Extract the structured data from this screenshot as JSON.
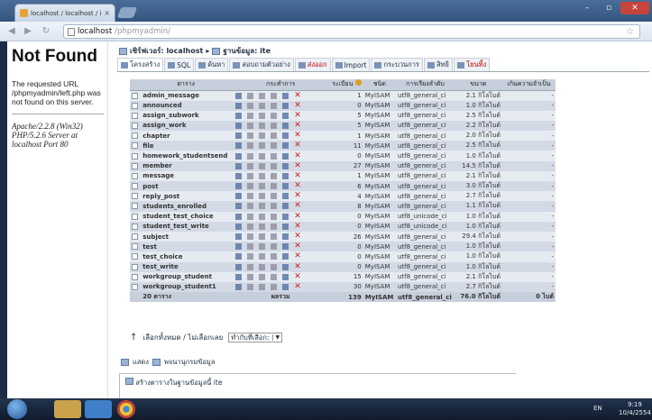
{
  "browser": {
    "tab_title": "localhost / localhost / ite ...",
    "url_host": "localhost",
    "url_path": "/phpmyadmin/"
  },
  "not_found": {
    "title": "Not Found",
    "message": "The requested URL /phpmyadmin/left.php was not found on this server.",
    "server": "Apache/2.2.8 (Win32) PHP/5.2.6 Server at localhost Port 80"
  },
  "breadcrumb": {
    "server": "เซิร์ฟเวอร์: localhost",
    "sep": "▸",
    "db": "ฐานข้อมูล: ite"
  },
  "tabs": [
    {
      "label": "โครงสร้าง",
      "style": "active"
    },
    {
      "label": "SQL",
      "style": ""
    },
    {
      "label": "ค้นหา",
      "style": ""
    },
    {
      "label": "สอบถามตัวอย่าง",
      "style": ""
    },
    {
      "label": "ส่งออก",
      "style": "red"
    },
    {
      "label": "Import",
      "style": ""
    },
    {
      "label": "กระบวนการ",
      "style": ""
    },
    {
      "label": "สิทธิ",
      "style": ""
    },
    {
      "label": "โยนทิ้ง",
      "style": "red"
    }
  ],
  "table_headers": {
    "table": "ตาราง",
    "action": "กระทำการ",
    "records": "ระเบียน",
    "type": "ชนิด",
    "collation": "การเรียงลำดับ",
    "size": "ขนาด",
    "overhead": "เกินความจำเป็น"
  },
  "tables": [
    {
      "name": "admin_message",
      "records": "1",
      "engine": "MyISAM",
      "collation": "utf8_general_ci",
      "size": "2.1 กิโลไบต์",
      "overhead": "-"
    },
    {
      "name": "announced",
      "records": "0",
      "engine": "MyISAM",
      "collation": "utf8_general_ci",
      "size": "1.0 กิโลไบต์",
      "overhead": "-"
    },
    {
      "name": "assign_subwork",
      "records": "5",
      "engine": "MyISAM",
      "collation": "utf8_general_ci",
      "size": "2.5 กิโลไบต์",
      "overhead": "-"
    },
    {
      "name": "assign_work",
      "records": "5",
      "engine": "MyISAM",
      "collation": "utf8_general_ci",
      "size": "2.2 กิโลไบต์",
      "overhead": "-"
    },
    {
      "name": "chapter",
      "records": "1",
      "engine": "MyISAM",
      "collation": "utf8_general_ci",
      "size": "2.0 กิโลไบต์",
      "overhead": "-"
    },
    {
      "name": "file",
      "records": "11",
      "engine": "MyISAM",
      "collation": "utf8_general_ci",
      "size": "2.5 กิโลไบต์",
      "overhead": "-"
    },
    {
      "name": "homework_studentsend",
      "records": "0",
      "engine": "MyISAM",
      "collation": "utf8_general_ci",
      "size": "1.0 กิโลไบต์",
      "overhead": "-"
    },
    {
      "name": "member",
      "records": "27",
      "engine": "MyISAM",
      "collation": "utf8_general_ci",
      "size": "14.5 กิโลไบต์",
      "overhead": "-"
    },
    {
      "name": "message",
      "records": "1",
      "engine": "MyISAM",
      "collation": "utf8_general_ci",
      "size": "2.1 กิโลไบต์",
      "overhead": "-"
    },
    {
      "name": "post",
      "records": "6",
      "engine": "MyISAM",
      "collation": "utf8_general_ci",
      "size": "3.0 กิโลไบต์",
      "overhead": "-"
    },
    {
      "name": "reply_post",
      "records": "4",
      "engine": "MyISAM",
      "collation": "utf8_general_ci",
      "size": "2.7 กิโลไบต์",
      "overhead": "-"
    },
    {
      "name": "students_enrolled",
      "records": "8",
      "engine": "MyISAM",
      "collation": "utf8_general_ci",
      "size": "1.1 กิโลไบต์",
      "overhead": "-"
    },
    {
      "name": "student_test_choice",
      "records": "0",
      "engine": "MyISAM",
      "collation": "utf8_unicode_ci",
      "size": "1.0 กิโลไบต์",
      "overhead": "-"
    },
    {
      "name": "student_test_write",
      "records": "0",
      "engine": "MyISAM",
      "collation": "utf8_unicode_ci",
      "size": "1.0 กิโลไบต์",
      "overhead": "-"
    },
    {
      "name": "subject",
      "records": "26",
      "engine": "MyISAM",
      "collation": "utf8_general_ci",
      "size": "29.4 กิโลไบต์",
      "overhead": "-"
    },
    {
      "name": "test",
      "records": "0",
      "engine": "MyISAM",
      "collation": "utf8_general_ci",
      "size": "1.0 กิโลไบต์",
      "overhead": "-"
    },
    {
      "name": "test_choice",
      "records": "0",
      "engine": "MyISAM",
      "collation": "utf8_general_ci",
      "size": "1.0 กิโลไบต์",
      "overhead": "-"
    },
    {
      "name": "test_write",
      "records": "0",
      "engine": "MyISAM",
      "collation": "utf8_general_ci",
      "size": "1.0 กิโลไบต์",
      "overhead": "-"
    },
    {
      "name": "workgroup_student",
      "records": "15",
      "engine": "MyISAM",
      "collation": "utf8_general_ci",
      "size": "2.1 กิโลไบต์",
      "overhead": "-"
    },
    {
      "name": "workgroup_student1",
      "records": "30",
      "engine": "MyISAM",
      "collation": "utf8_general_ci",
      "size": "2.7 กิโลไบต์",
      "overhead": "-"
    }
  ],
  "footer_row": {
    "count": "20 ตาราง",
    "label": "ผลรวม",
    "records": "139",
    "engine": "MyISAM",
    "collation": "utf8_general_ci",
    "size": "76.0 กิโลไบต์",
    "overhead": "0 ไบต์"
  },
  "below_table": {
    "check_all": "เลือกทั้งหมด / ไม่เลือกเลย",
    "with_selected": "ทำกับที่เลือก:"
  },
  "links": {
    "print": "แสดง",
    "dictionary": "พจนานุกรมข้อมูล"
  },
  "create_table": {
    "legend": "สร้างตารางในฐานข้อมูลนี้ ite"
  },
  "taskbar": {
    "lang": "EN",
    "time": "9:19",
    "date": "10/4/2554"
  }
}
